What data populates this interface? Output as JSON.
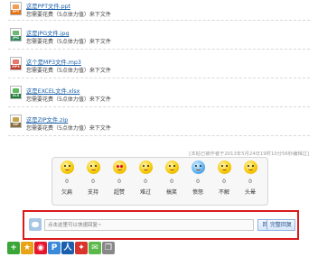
{
  "files": [
    {
      "name": "这是PPT文件.ppt",
      "hint": "您需要花费（5点体力值）来下文件",
      "ext": "PPT",
      "tag_color": "#e46c0a",
      "art_color": "#f0a050"
    },
    {
      "name": "这是JPG文件.jpg",
      "hint": "您需要花费（5点体力值）来下文件",
      "ext": "JPG",
      "tag_color": "#2e8b57",
      "art_color": "#6fb86f"
    },
    {
      "name": "这个是MP3文件.mp3",
      "hint": "您需要花费（5点体力值）来下文件",
      "ext": "MP3",
      "tag_color": "#c0392b",
      "art_color": "#e5776c"
    },
    {
      "name": "这是EXCEL文件.xlsx",
      "hint": "您需要花费（5点体力值）来下文件",
      "ext": "XLS",
      "tag_color": "#1e7a34",
      "art_color": "#5cb85c"
    },
    {
      "name": "这是ZIP文件.zip",
      "hint": "您需要花费（5点体力值）来下文件",
      "ext": "ZIP",
      "tag_color": "#8a6d3b",
      "art_color": "#c9a34a"
    }
  ],
  "meta_note": "[本帖已被作者于2013年5月24日19时10分56秒编辑过]",
  "moods": [
    {
      "label": "欠扁",
      "count": "0",
      "icon": "mood-beat-icon"
    },
    {
      "label": "支持",
      "count": "0",
      "icon": "mood-support-icon"
    },
    {
      "label": "超赞",
      "count": "0",
      "icon": "mood-awesome-icon"
    },
    {
      "label": "难过",
      "count": "0",
      "icon": "mood-sad-icon"
    },
    {
      "label": "搞笑",
      "count": "0",
      "icon": "mood-funny-icon"
    },
    {
      "label": "愤怒",
      "count": "0",
      "icon": "mood-angry-icon"
    },
    {
      "label": "不解",
      "count": "0",
      "icon": "mood-confused-icon"
    },
    {
      "label": "头晕",
      "count": "0",
      "icon": "mood-dizzy-icon"
    }
  ],
  "reply": {
    "placeholder": "点击这里可以快速回复~",
    "submit_label": "回 复",
    "full_label": "完整回复"
  },
  "share_icons": [
    {
      "name": "share-add-icon",
      "glyph": "+",
      "color": "#3aa63a"
    },
    {
      "name": "share-qzone-icon",
      "glyph": "★",
      "color": "#e8a317"
    },
    {
      "name": "share-weibo-icon",
      "glyph": "◉",
      "color": "#e6162d"
    },
    {
      "name": "share-pengyou-icon",
      "glyph": "P",
      "color": "#3b8ad9"
    },
    {
      "name": "share-renren-icon",
      "glyph": "人",
      "color": "#1c5fae"
    },
    {
      "name": "share-kaixin-icon",
      "glyph": "✦",
      "color": "#d9342b"
    },
    {
      "name": "share-wechat-icon",
      "glyph": "✉",
      "color": "#5ab94a"
    },
    {
      "name": "share-copy-icon",
      "glyph": "❐",
      "color": "#888888"
    }
  ]
}
